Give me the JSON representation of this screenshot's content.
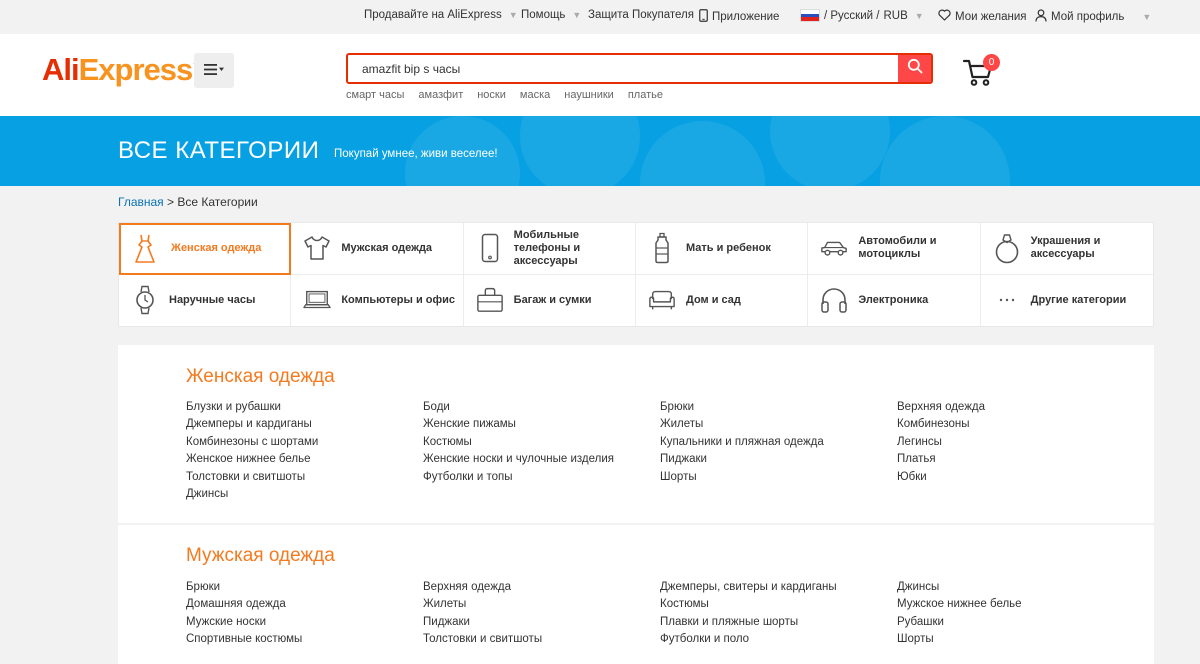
{
  "topbar": {
    "sell": "Продавайте на AliExpress",
    "help": "Помощь",
    "buyer_protection": "Защита Покупателя",
    "app": "Приложение",
    "lang": "/ Русский /",
    "currency": "RUB",
    "wishlist": "Мои желания",
    "profile": "Мой профиль"
  },
  "header": {
    "logo_part1": "Ali",
    "logo_part2": "Express",
    "logo_tm": "™",
    "search_value": "amazfit bip s часы",
    "hot_searches": [
      "смарт часы",
      "амазфит",
      "носки",
      "маска",
      "наушники",
      "платье"
    ],
    "cart_count": "0"
  },
  "banner": {
    "title": "ВСЕ КАТЕГОРИИ",
    "slogan": "Покупай умнее, живи веселее!"
  },
  "breadcrumb": {
    "home": "Главная",
    "separator": " > ",
    "current": "Все Категории"
  },
  "categories": [
    {
      "label": "Женская одежда",
      "icon": "dress-icon"
    },
    {
      "label": "Мужская одежда",
      "icon": "tshirt-icon"
    },
    {
      "label": "Мобильные телефоны и аксессуары",
      "icon": "phone-icon"
    },
    {
      "label": "Мать и ребенок",
      "icon": "baby-bottle-icon"
    },
    {
      "label": "Автомобили и мотоциклы",
      "icon": "car-icon"
    },
    {
      "label": "Украшения и аксессуары",
      "icon": "ring-icon"
    },
    {
      "label": "Наручные часы",
      "icon": "watch-icon"
    },
    {
      "label": "Компьютеры и офис",
      "icon": "laptop-icon"
    },
    {
      "label": "Багаж и сумки",
      "icon": "bag-icon"
    },
    {
      "label": "Дом и сад",
      "icon": "sofa-icon"
    },
    {
      "label": "Электроника",
      "icon": "headphones-icon"
    },
    {
      "label": "Другие категории",
      "icon": "more-dots-icon"
    }
  ],
  "colors": {
    "accent_orange": "#f47a20",
    "search_red": "#e62e04",
    "banner_blue": "#07a1e3",
    "link_blue": "#0a72b5"
  },
  "sections": [
    {
      "title": "Женская одежда",
      "columns": [
        [
          "Блузки и рубашки",
          "Джемперы и кардиганы",
          "Комбинезоны с шортами",
          "Женское нижнее белье",
          "Толстовки и свитшоты",
          "Джинсы"
        ],
        [
          "Боди",
          "Женские пижамы",
          "Костюмы",
          "Женские носки и чулочные изделия",
          "Футболки и топы"
        ],
        [
          "Брюки",
          "Жилеты",
          "Купальники и пляжная одежда",
          "Пиджаки",
          "Шорты"
        ],
        [
          "Верхняя одежда",
          "Комбинезоны",
          "Легинсы",
          "Платья",
          "Юбки"
        ]
      ]
    },
    {
      "title": "Мужская одежда",
      "columns": [
        [
          "Брюки",
          "Домашняя одежда",
          "Мужские носки",
          "Спортивные костюмы"
        ],
        [
          "Верхняя одежда",
          "Жилеты",
          "Пиджаки",
          "Толстовки и свитшоты"
        ],
        [
          "Джемперы, свитеры и кардиганы",
          "Костюмы",
          "Плавки и пляжные шорты",
          "Футболки и поло"
        ],
        [
          "Джинсы",
          "Мужское нижнее белье",
          "Рубашки",
          "Шорты"
        ]
      ]
    }
  ]
}
